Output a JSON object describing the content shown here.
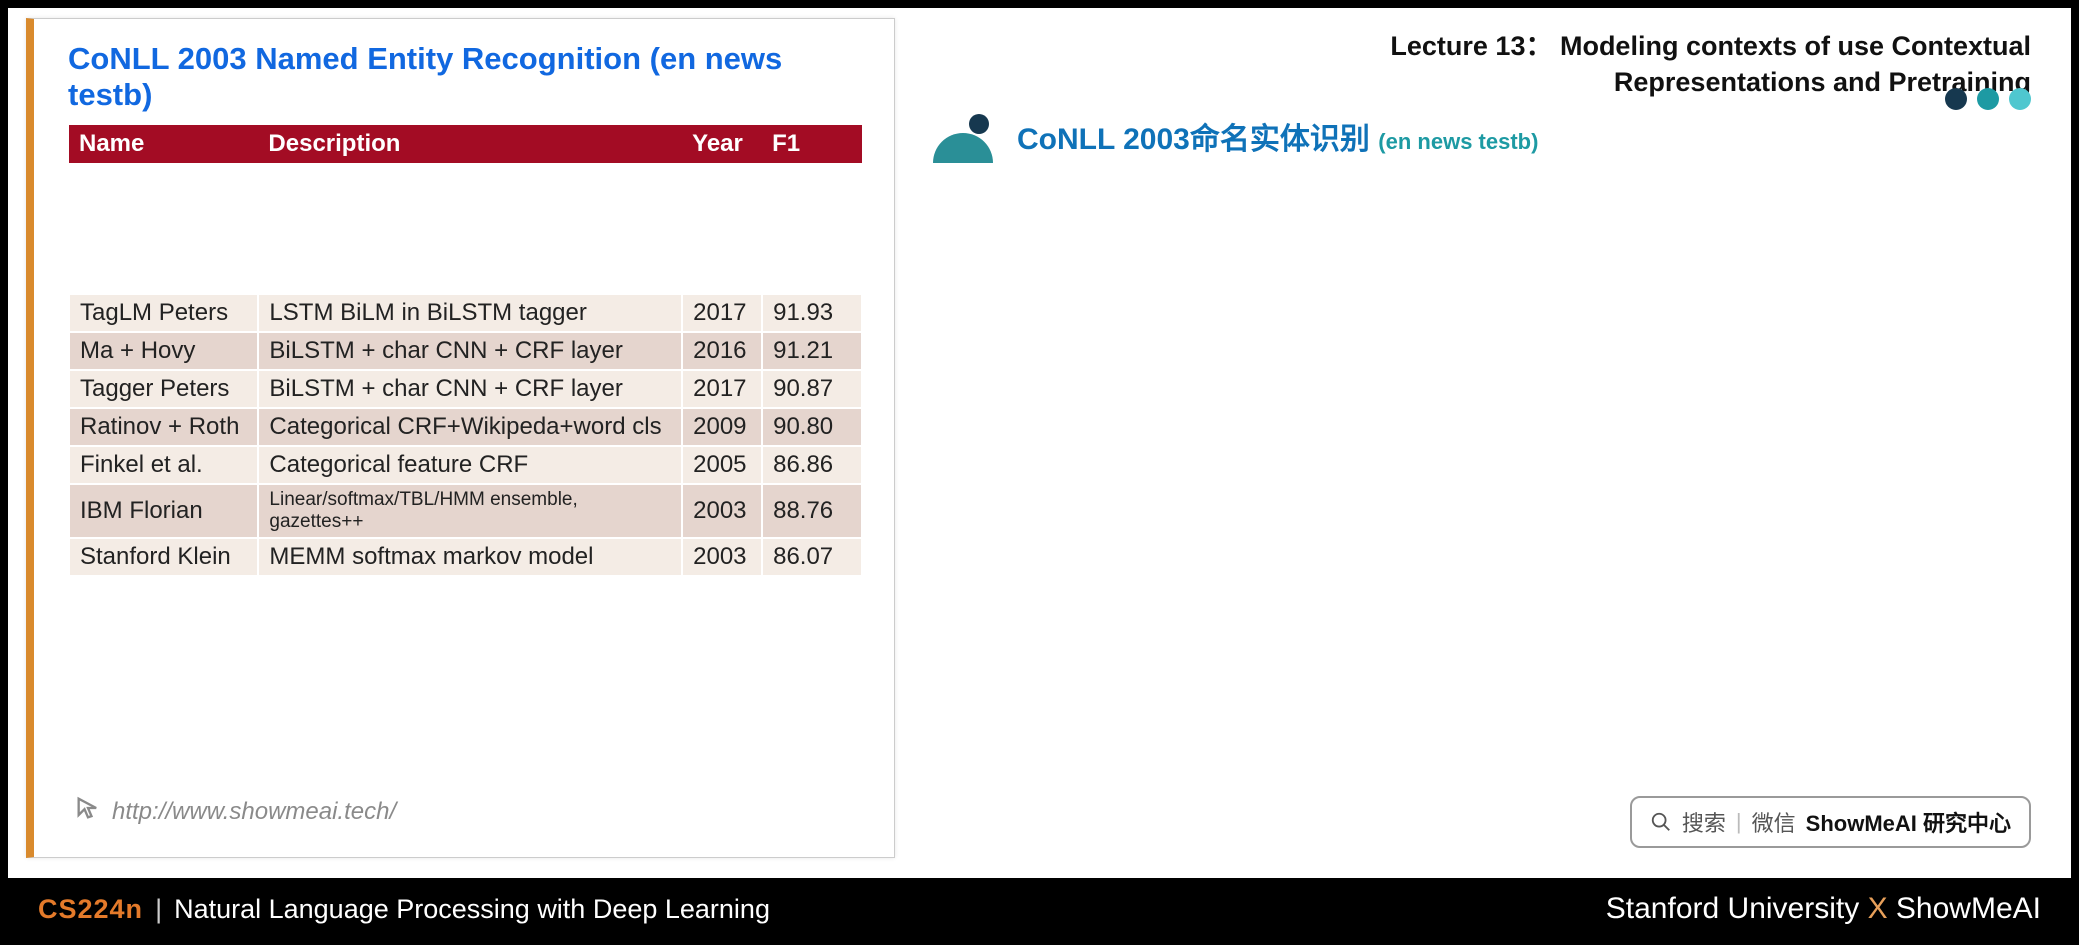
{
  "lecture_title_line1": "Lecture 13： Modeling contexts of use Contextual",
  "lecture_title_line2": "Representations and Pretraining",
  "section_title_main": "CoNLL 2003命名实体识别",
  "section_title_sub": "(en news testb)",
  "slide": {
    "title": "CoNLL 2003 Named Entity Recognition (en news testb)",
    "headers": {
      "name": "Name",
      "description": "Description",
      "year": "Year",
      "f1": "F1"
    },
    "rows": [
      {
        "name": "TagLM Peters",
        "desc": "LSTM BiLM in BiLSTM tagger",
        "year": "2017",
        "f1": "91.93",
        "shade": "light",
        "small": false
      },
      {
        "name": "Ma + Hovy",
        "desc": "BiLSTM + char CNN + CRF layer",
        "year": "2016",
        "f1": "91.21",
        "shade": "dark",
        "small": false
      },
      {
        "name": "Tagger Peters",
        "desc": "BiLSTM + char CNN + CRF layer",
        "year": "2017",
        "f1": "90.87",
        "shade": "light",
        "small": false
      },
      {
        "name": "Ratinov + Roth",
        "desc": "Categorical CRF+Wikipeda+word cls",
        "year": "2009",
        "f1": "90.80",
        "shade": "dark",
        "small": false
      },
      {
        "name": "Finkel et al.",
        "desc": "Categorical feature CRF",
        "year": "2005",
        "f1": "86.86",
        "shade": "light",
        "small": false
      },
      {
        "name": "IBM Florian",
        "desc": "Linear/softmax/TBL/HMM ensemble, gazettes++",
        "year": "2003",
        "f1": "88.76",
        "shade": "dark",
        "small": true
      },
      {
        "name": "Stanford Klein",
        "desc": "MEMM softmax markov model",
        "year": "2003",
        "f1": "86.07",
        "shade": "light",
        "small": false
      }
    ],
    "footer_url": "http://www.showmeai.tech/"
  },
  "search": {
    "placeholder": "搜索",
    "source_label": "微信",
    "strong": "ShowMeAI 研究中心"
  },
  "bottom": {
    "course_code": "CS224n",
    "separator": "|",
    "course_name": "Natural Language Processing with Deep Learning",
    "org_left": "Stanford University",
    "x": "X",
    "org_right": "ShowMeAI"
  },
  "chart_data": {
    "type": "table",
    "title": "CoNLL 2003 Named Entity Recognition (en news testb)",
    "columns": [
      "Name",
      "Description",
      "Year",
      "F1"
    ],
    "rows": [
      [
        "TagLM Peters",
        "LSTM BiLM in BiLSTM tagger",
        2017,
        91.93
      ],
      [
        "Ma + Hovy",
        "BiLSTM + char CNN + CRF layer",
        2016,
        91.21
      ],
      [
        "Tagger Peters",
        "BiLSTM + char CNN + CRF layer",
        2017,
        90.87
      ],
      [
        "Ratinov + Roth",
        "Categorical CRF+Wikipeda+word cls",
        2009,
        90.8
      ],
      [
        "Finkel et al.",
        "Categorical feature CRF",
        2005,
        86.86
      ],
      [
        "IBM Florian",
        "Linear/softmax/TBL/HMM ensemble, gazettes++",
        2003,
        88.76
      ],
      [
        "Stanford Klein",
        "MEMM softmax markov model",
        2003,
        86.07
      ]
    ]
  }
}
